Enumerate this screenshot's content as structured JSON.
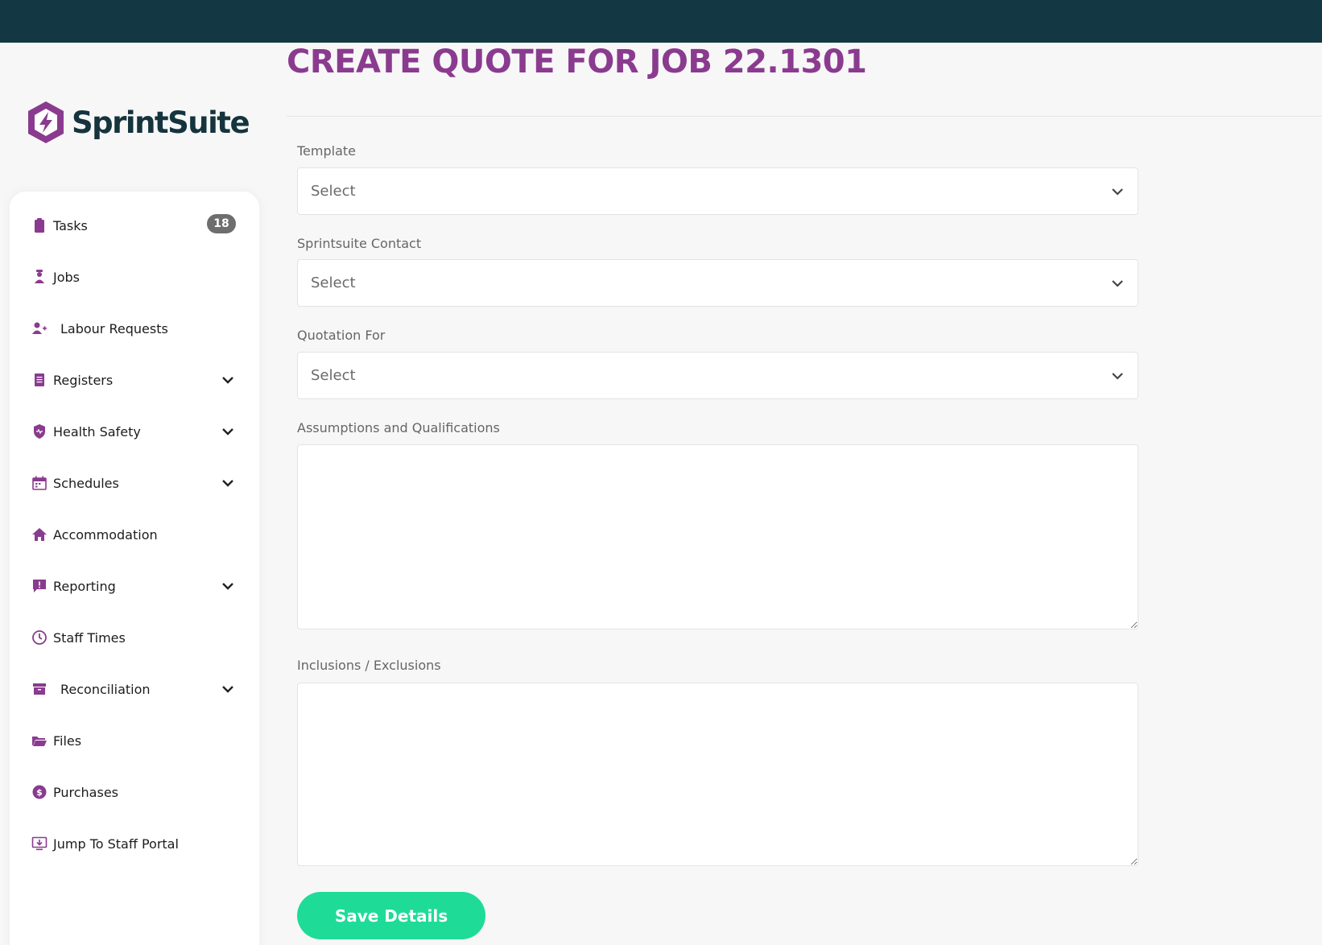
{
  "app": {
    "brand": "SprintSuite",
    "accent": "#8a3b8f",
    "topbar_color": "#143843",
    "button_color": "#1edc98"
  },
  "page": {
    "title": "CREATE QUOTE FOR JOB 22.1301"
  },
  "sidebar": {
    "items": [
      {
        "label": "Tasks",
        "icon": "clipboard-icon",
        "badge": "18"
      },
      {
        "label": "Jobs",
        "icon": "worker-icon"
      },
      {
        "label": "Labour Requests",
        "icon": "user-plus-icon"
      },
      {
        "label": "Registers",
        "icon": "register-icon",
        "expandable": true
      },
      {
        "label": "Health Safety",
        "icon": "shield-icon",
        "expandable": true
      },
      {
        "label": "Schedules",
        "icon": "calendar-icon",
        "expandable": true
      },
      {
        "label": "Accommodation",
        "icon": "home-icon"
      },
      {
        "label": "Reporting",
        "icon": "report-icon",
        "expandable": true
      },
      {
        "label": "Staff Times",
        "icon": "clock-icon"
      },
      {
        "label": "Reconciliation",
        "icon": "archive-icon",
        "expandable": true
      },
      {
        "label": "Files",
        "icon": "folder-icon"
      },
      {
        "label": "Purchases",
        "icon": "dollar-icon"
      },
      {
        "label": "Jump To Staff Portal",
        "icon": "portal-icon"
      }
    ]
  },
  "form": {
    "template": {
      "label": "Template",
      "value": "Select"
    },
    "contact": {
      "label": "Sprintsuite Contact",
      "value": "Select"
    },
    "quotation_for": {
      "label": "Quotation For",
      "value": "Select"
    },
    "assumptions": {
      "label": "Assumptions and Qualifications",
      "value": ""
    },
    "inclusions": {
      "label": "Inclusions / Exclusions",
      "value": ""
    },
    "save_label": "Save Details"
  }
}
